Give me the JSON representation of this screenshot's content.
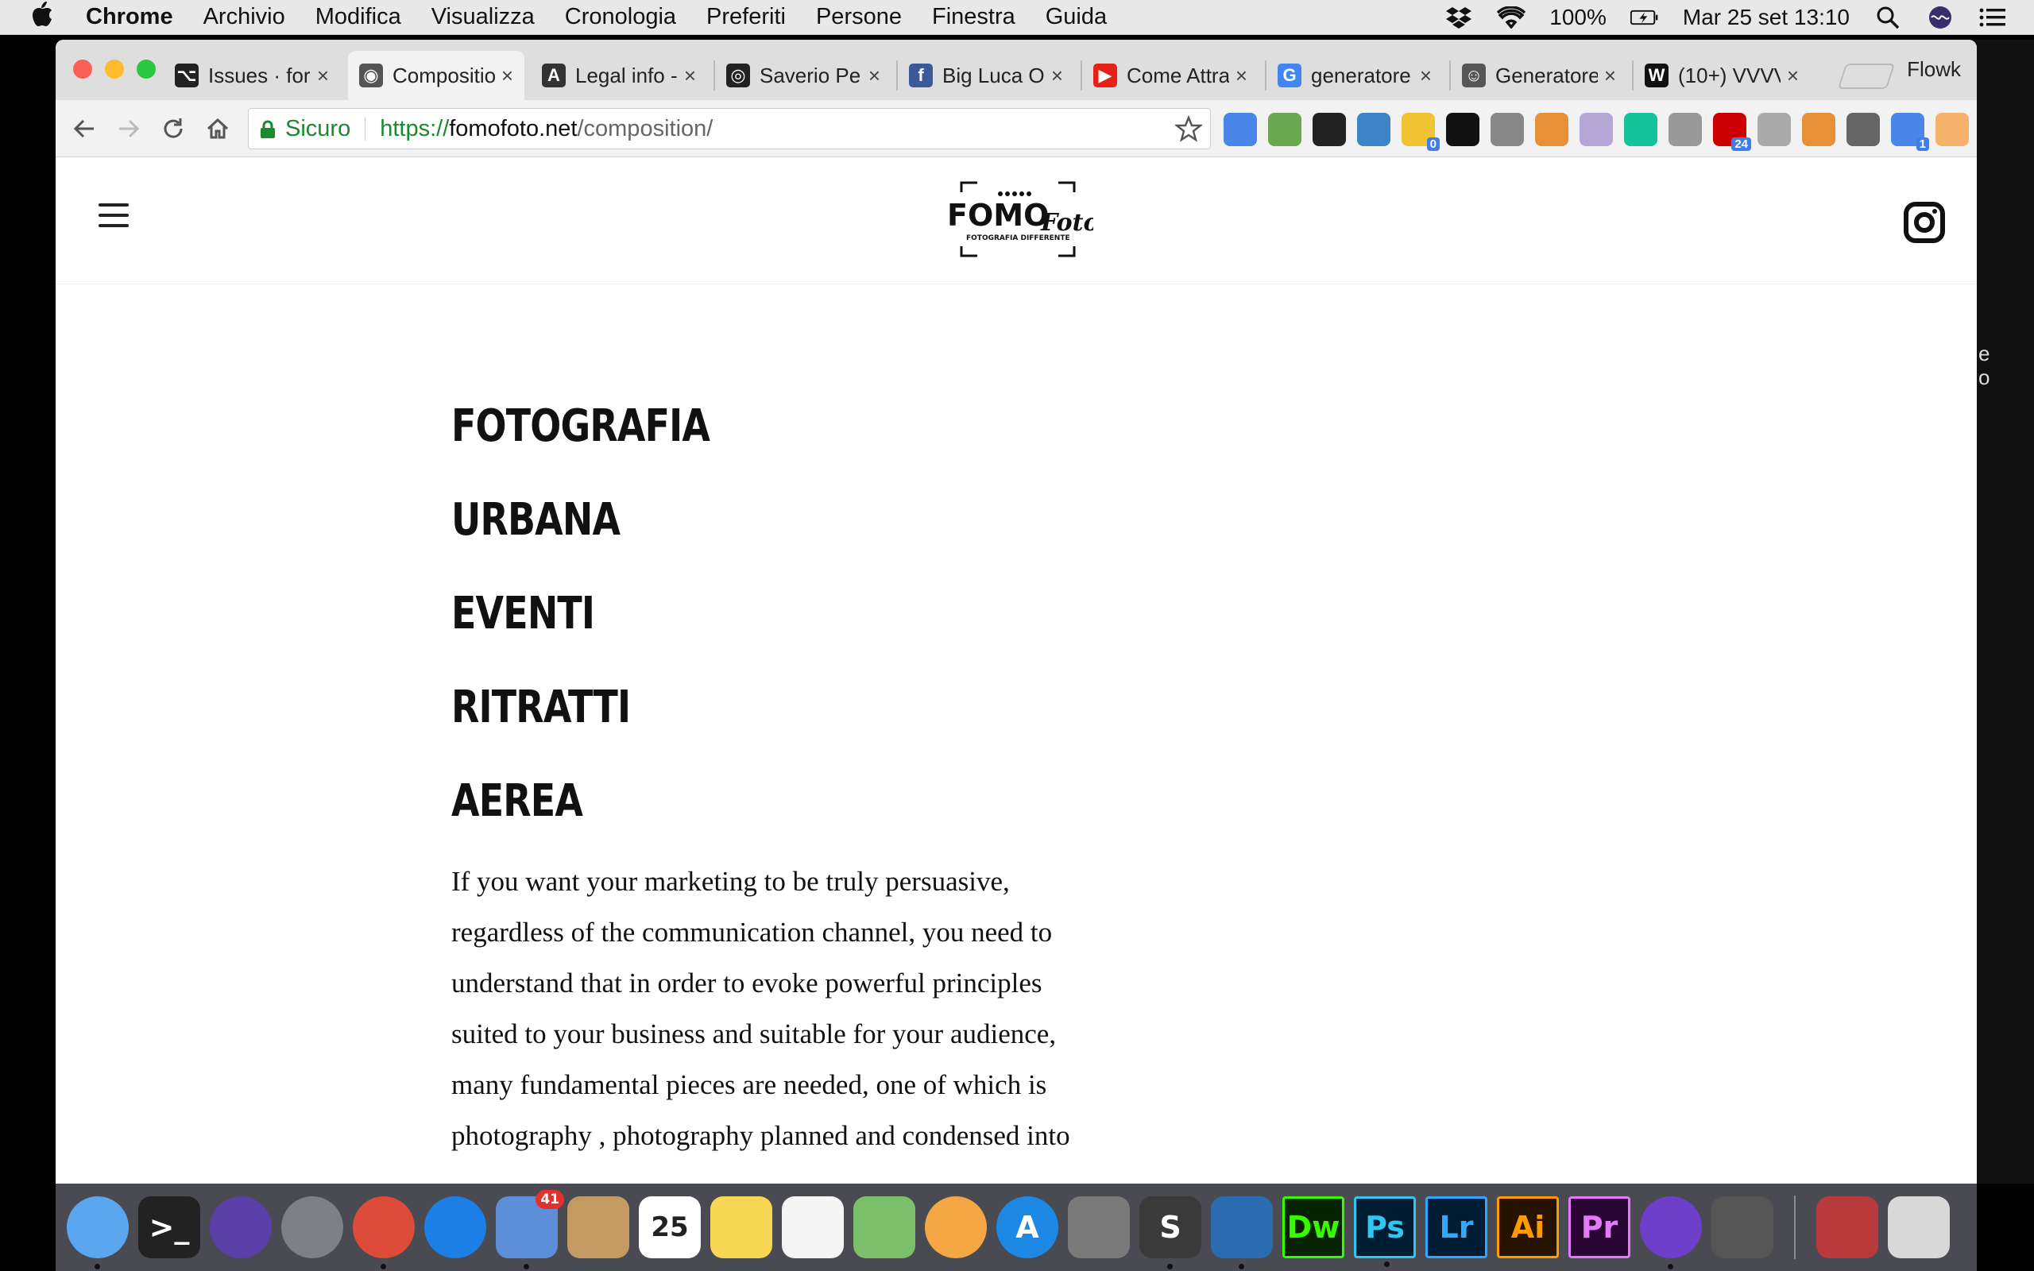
{
  "menubar": {
    "app_name": "Chrome",
    "items": [
      "Archivio",
      "Modifica",
      "Visualizza",
      "Cronologia",
      "Preferiti",
      "Persone",
      "Finestra",
      "Guida"
    ],
    "battery": "100%",
    "clock": "Mar 25 set  13:10",
    "icons": [
      "dropbox-icon",
      "wifi-icon",
      "battery-icon",
      "spotlight-icon",
      "siri-icon",
      "notification-center-icon"
    ]
  },
  "browser": {
    "tabs": [
      {
        "title": "Issues · for",
        "icon": "github-icon",
        "fav_color": "#222222"
      },
      {
        "title": "Compositio",
        "icon": "camera-icon",
        "fav_color": "#555555"
      },
      {
        "title": "Legal info -",
        "icon": "compass-icon",
        "fav_color": "#333333"
      },
      {
        "title": "Saverio Pe",
        "icon": "aperture-icon",
        "fav_color": "#222222"
      },
      {
        "title": "Big Luca O",
        "icon": "facebook-icon",
        "fav_color": "#3b5998"
      },
      {
        "title": "Come Attra",
        "icon": "youtube-icon",
        "fav_color": "#e62117"
      },
      {
        "title": "generatore",
        "icon": "google-icon",
        "fav_color": "#4285f4"
      },
      {
        "title": "Generatore",
        "icon": "robot-icon",
        "fav_color": "#555555"
      },
      {
        "title": "(10+) VVVV",
        "icon": "vvvv-icon",
        "fav_color": "#111111"
      }
    ],
    "active_tab_index": 1,
    "profile_name": "Flowk",
    "omnibox": {
      "secure_label": "Sicuro",
      "url_scheme": "https://",
      "url_host": "fomofoto.net",
      "url_path": "/composition/"
    },
    "extensions": [
      {
        "icon": "translate-icon",
        "color": "#4a86e8"
      },
      {
        "icon": "chart-icon",
        "color": "#6aa84f"
      },
      {
        "icon": "record-icon",
        "color": "#222222"
      },
      {
        "icon": "download-icon",
        "color": "#3d85c6"
      },
      {
        "icon": "folder-icon",
        "color": "#f1c232",
        "badge": "0"
      },
      {
        "icon": "rocket-icon",
        "color": "#111111"
      },
      {
        "icon": "link-icon",
        "color": "#888888"
      },
      {
        "icon": "rainbow-icon",
        "color": "#e69138"
      },
      {
        "icon": "gem-icon",
        "color": "#b4a7d6"
      },
      {
        "icon": "grammarly-icon",
        "color": "#15c39a"
      },
      {
        "icon": "puzzle-icon",
        "color": "#999999"
      },
      {
        "icon": "lock-badge-icon",
        "color": "#cc0000",
        "badge": "24"
      },
      {
        "icon": "camera-ext-icon",
        "color": "#aaaaaa"
      },
      {
        "icon": "fox-icon",
        "color": "#e69138"
      },
      {
        "icon": "pen-icon",
        "color": "#666666"
      },
      {
        "icon": "code-icon",
        "color": "#4a86e8",
        "badge": "1"
      },
      {
        "icon": "arrow-up-icon",
        "color": "#f6b26b"
      }
    ]
  },
  "site": {
    "logo_text": "FOMO",
    "logo_script": "Foto",
    "logo_tagline": "FOTOGRAFIA DIFFERENTE",
    "categories": [
      "FOTOGRAFIA",
      "URBANA",
      "EVENTI",
      "RITRATTI",
      "AEREA"
    ],
    "body_lines": [
      "If you want your marketing to be truly persuasive,",
      "regardless of the communication channel, you need to",
      "understand that in order to evoke powerful principles",
      "suited to your business and suitable for your audience,",
      "many fundamental pieces are needed, one of which is",
      "photography , photography planned and condensed into"
    ]
  },
  "side_peek": [
    "e",
    "o"
  ],
  "dock": {
    "apps": [
      {
        "icon": "finder-icon",
        "color": "#5aa7f0",
        "label": "",
        "running": true
      },
      {
        "icon": "terminal-icon",
        "color": "#222222",
        "label": ">_",
        "running": false
      },
      {
        "icon": "siri-app-icon",
        "color": "#5b3fa8",
        "label": "",
        "running": false
      },
      {
        "icon": "launchpad-icon",
        "color": "#7d8087",
        "label": "",
        "running": false
      },
      {
        "icon": "chrome-icon",
        "color": "#dd4b39",
        "label": "",
        "running": true
      },
      {
        "icon": "safari-icon",
        "color": "#1d7ee6",
        "label": "",
        "running": false
      },
      {
        "icon": "mail-icon",
        "color": "#5d8fd8",
        "label": "",
        "running": true,
        "badge": "41"
      },
      {
        "icon": "contacts-icon",
        "color": "#c49a63",
        "label": "",
        "running": false
      },
      {
        "icon": "calendar-icon",
        "color": "#ffffff",
        "label": "25",
        "running": false
      },
      {
        "icon": "notes-icon",
        "color": "#f7d654",
        "label": "",
        "running": false
      },
      {
        "icon": "reminders-icon",
        "color": "#f5f5f5",
        "label": "",
        "running": false
      },
      {
        "icon": "maps-icon",
        "color": "#7bbf6a",
        "label": "",
        "running": false
      },
      {
        "icon": "photos-icon",
        "color": "#f4a742",
        "label": "",
        "running": false
      },
      {
        "icon": "app-store-icon",
        "color": "#1e88e5",
        "label": "A",
        "running": false
      },
      {
        "icon": "system-preferences-icon",
        "color": "#7a7a7a",
        "label": "",
        "running": false
      },
      {
        "icon": "sublime-text-icon",
        "color": "#3a3a3a",
        "label": "S",
        "running": true
      },
      {
        "icon": "vscode-icon",
        "color": "#2b6cb0",
        "label": "",
        "running": true
      },
      {
        "icon": "dreamweaver-icon",
        "color": "#072401",
        "label": "Dw",
        "running": false
      },
      {
        "icon": "photoshop-icon",
        "color": "#001d34",
        "label": "Ps",
        "running": true
      },
      {
        "icon": "lightroom-icon",
        "color": "#001d34",
        "label": "Lr",
        "running": false
      },
      {
        "icon": "illustrator-icon",
        "color": "#261300",
        "label": "Ai",
        "running": false
      },
      {
        "icon": "premiere-icon",
        "color": "#2a0634",
        "label": "Pr",
        "running": false
      },
      {
        "icon": "github-desktop-icon",
        "color": "#6e40c9",
        "label": "",
        "running": true
      },
      {
        "icon": "photo-booth-icon",
        "color": "#555555",
        "label": "",
        "running": false
      }
    ],
    "trailing": [
      {
        "icon": "downloads-stack-icon",
        "color": "#b93a3a"
      },
      {
        "icon": "trash-icon",
        "color": "#d8d8d8"
      }
    ],
    "colors": {
      "dreamweaver_fg": "#35fa00",
      "photoshop_fg": "#31c5f0",
      "lightroom_fg": "#31a8ff",
      "illustrator_fg": "#ff9a00",
      "premiere_fg": "#e579fe"
    }
  }
}
